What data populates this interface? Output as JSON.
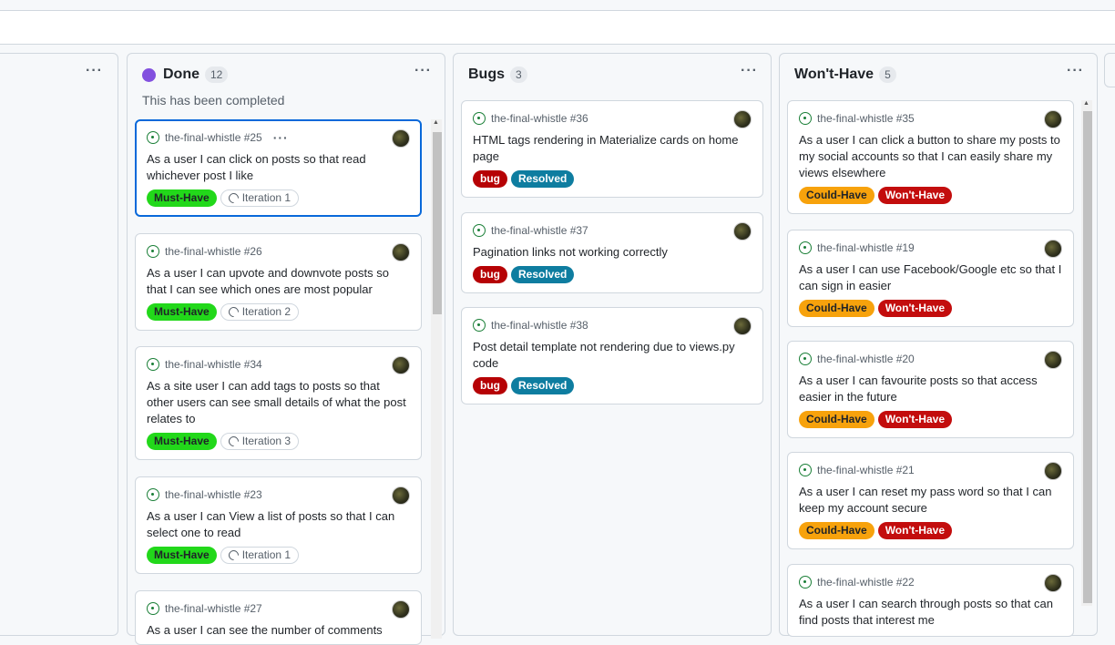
{
  "columns": {
    "prev": {
      "menu": "···"
    },
    "done": {
      "title": "Done",
      "count": "12",
      "description": "This has been completed",
      "menu": "···",
      "cards": [
        {
          "repo": "the-final-whistle #25",
          "more": "···",
          "title": "As a user I can click on posts so that read whichever post I like",
          "priority": "Must-Have",
          "iteration": "Iteration 1"
        },
        {
          "repo": "the-final-whistle #26",
          "title": "As a user I can upvote and downvote posts so that I can see which ones are most popular",
          "priority": "Must-Have",
          "iteration": "Iteration 2"
        },
        {
          "repo": "the-final-whistle #34",
          "title": "As a site user I can add tags to posts so that other users can see small details of what the post relates to",
          "priority": "Must-Have",
          "iteration": "Iteration 3"
        },
        {
          "repo": "the-final-whistle #23",
          "title": "As a user I can View a list of posts so that I can select one to read",
          "priority": "Must-Have",
          "iteration": "Iteration 1"
        },
        {
          "repo": "the-final-whistle #27",
          "title": "As a user I can see the number of comments"
        }
      ]
    },
    "bugs": {
      "title": "Bugs",
      "count": "3",
      "menu": "···",
      "cards": [
        {
          "repo": "the-final-whistle #36",
          "title": "HTML tags rendering in Materialize cards on home page",
          "label1": "bug",
          "label2": "Resolved"
        },
        {
          "repo": "the-final-whistle #37",
          "title": "Pagination links not working correctly",
          "label1": "bug",
          "label2": "Resolved"
        },
        {
          "repo": "the-final-whistle #38",
          "title": "Post detail template not rendering due to views.py code",
          "label1": "bug",
          "label2": "Resolved"
        }
      ]
    },
    "wont": {
      "title": "Won't-Have",
      "count": "5",
      "menu": "···",
      "cards": [
        {
          "repo": "the-final-whistle #35",
          "title": "As a user I can click a button to share my posts to my social accounts so that I can easily share my views elsewhere",
          "label1": "Could-Have",
          "label2": "Won't-Have"
        },
        {
          "repo": "the-final-whistle #19",
          "title": "As a user I can use Facebook/Google etc so that I can sign in easier",
          "label1": "Could-Have",
          "label2": "Won't-Have"
        },
        {
          "repo": "the-final-whistle #20",
          "title": "As a user I can favourite posts so that access easier in the future",
          "label1": "Could-Have",
          "label2": "Won't-Have"
        },
        {
          "repo": "the-final-whistle #21",
          "title": "As a user I can reset my pass word so that I can keep my account secure",
          "label1": "Could-Have",
          "label2": "Won't-Have"
        },
        {
          "repo": "the-final-whistle #22",
          "title": "As a user I can search through posts so that can find posts that interest me"
        }
      ]
    }
  },
  "colors": {
    "done_status": "#8250df",
    "must_have": "#22d81a",
    "could_have": "#f7a20c",
    "wont_have": "#c30d0d",
    "bug": "#b60205",
    "resolved": "#0e7da0",
    "selected_border": "#0969da"
  }
}
